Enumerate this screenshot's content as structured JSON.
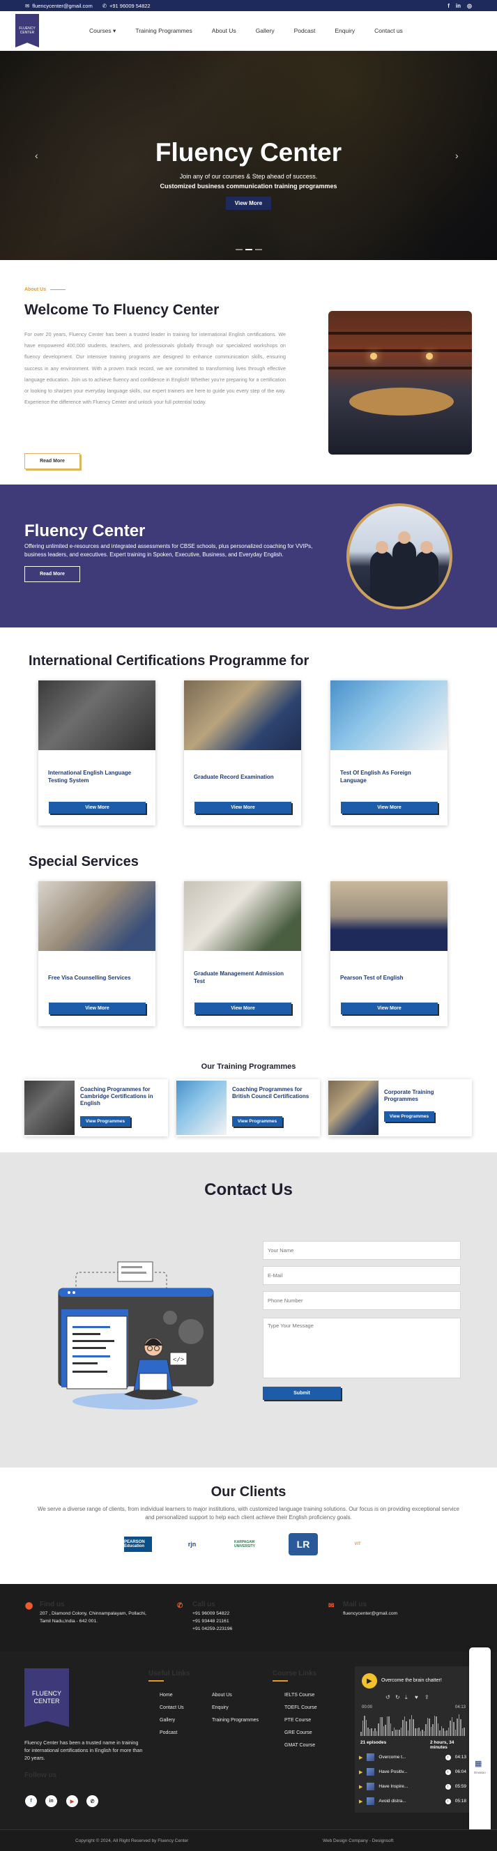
{
  "topbar": {
    "email": "fluencycenter@gmail.com",
    "phone": "+91 96009 54822",
    "social": [
      "f",
      "in",
      "◎"
    ]
  },
  "logo": {
    "line1": "FLUENCY",
    "line2": "CENTER"
  },
  "nav": {
    "items": [
      {
        "label": "Courses"
      },
      {
        "label": "Training Programmes"
      },
      {
        "label": "About Us"
      },
      {
        "label": "Gallery"
      },
      {
        "label": "Podcast"
      },
      {
        "label": "Enquiry"
      },
      {
        "label": "Contact us"
      }
    ]
  },
  "hero": {
    "title": "Fluency Center",
    "subtitle1": "Join any of our courses & Step ahead of success.",
    "subtitle2": "Customized business communication training programmes",
    "button": "View More"
  },
  "about": {
    "eyebrow": "About Us",
    "title": "Welcome To Fluency Center",
    "text": "For over 20 years, Fluency Center has been a trusted leader in training for international English certifications. We have empowered 400,000 students, teachers, and professionals globally through our specialized workshops on fluency development. Our intensive training programs are designed to enhance communication skills, ensuring success in any environment. With a proven track record, we are committed to transforming lives through effective language education. Join us to achieve fluency and confidence in English! Whether you're preparing for a certification or looking to sharpen your everyday language skills, our expert trainers are here to guide you every step of the way. Experience the difference with Fluency Center and unlock your full potential today.",
    "button": "Read More"
  },
  "band": {
    "title": "Fluency Center",
    "text": "Offering unlimited e-resources and integrated assessments for CBSE schools, plus personalized coaching for VVIPs, business leaders, and executives. Expert training in Spoken, Executive, Business, and Everyday English.",
    "button": "Read More"
  },
  "certifications": {
    "title": "International Certifications Programme for",
    "cards": [
      {
        "title": "International English Language Testing System",
        "button": "View More"
      },
      {
        "title": "Graduate Record Examination",
        "button": "View More"
      },
      {
        "title": "Test Of English As Foreign Language",
        "button": "View More"
      }
    ]
  },
  "services": {
    "title": "Special Services",
    "cards": [
      {
        "title": "Free Visa Counselling Services",
        "button": "View More"
      },
      {
        "title": "Graduate Management Admission Test",
        "button": "View More"
      },
      {
        "title": "Pearson Test of English",
        "button": "View More"
      }
    ]
  },
  "training": {
    "title": "Our Training Programmes",
    "cards": [
      {
        "title": "Coaching Programmes for Cambridge Certifications in English",
        "button": "View Programmes"
      },
      {
        "title": "Coaching Programmes for British Council Certifications",
        "button": "View Programmes"
      },
      {
        "title": "Corporate Training Programmes",
        "button": "View Programmes"
      }
    ]
  },
  "contact": {
    "title": "Contact Us",
    "name_placeholder": "Your Name",
    "email_placeholder": "E-Mail",
    "phone_placeholder": "Phone Number",
    "message_placeholder": "Type Your Message",
    "submit": "Submit"
  },
  "clients": {
    "title": "Our Clients",
    "text": "We serve a diverse range of clients, from individual learners to major institutions, with customized language training solutions. Our focus is on providing exceptional service and personalized support to help each client achieve their English proficiency goals.",
    "logos": [
      "PEARSON Education",
      "rjn",
      "KARPAGAM UNIVERSITY",
      "LR",
      "VIT"
    ]
  },
  "info": {
    "find_label": "Find us",
    "find_value1": "207 , Diamond Colony, Chinnampalayam, Pollachi,",
    "find_value2": "Tamil Nadu,India - 642 001.",
    "call_label": "Call us",
    "call_value1": "+91 96009 54822",
    "call_value2": "+91 93448 21161",
    "call_value3": "+91 04259-223196",
    "mail_label": "Mail us",
    "mail_value": "fluencycenter@gmail.com"
  },
  "footer": {
    "about": "Fluency Center has been a trusted name in training for international certifications in English for more than 20 years.",
    "follow": "Follow us",
    "useful_links_title": "Useful Links",
    "useful_links": [
      "Home",
      "Contact Us",
      "Gallery",
      "Podcast"
    ],
    "useful_links2": [
      "About Us",
      "Enquiry",
      "Training Programmes"
    ],
    "course_links_title": "Course Links",
    "course_links": [
      "IELTS Course",
      "TOEFL Course",
      "PTE Course",
      "GRE Course",
      "GMAT Course"
    ],
    "copyright": "Copyright © 2024, All Right Reserved by Fluency Center",
    "credit": "Web Design Company - Designsoft"
  },
  "podcast": {
    "title": "Overcome the brain chatter!",
    "time_start": "00:00",
    "time_end": "04:13",
    "episodes_count": "21 episodes",
    "duration": "2 hours, 34 minutes",
    "episodes": [
      {
        "name": "Overcome t...",
        "time": "04:13"
      },
      {
        "name": "Have Positiv...",
        "time": "06:04"
      },
      {
        "name": "Have Inspire...",
        "time": "05:59"
      },
      {
        "name": "Avoid distra...",
        "time": "05:18"
      }
    ]
  },
  "widget": {
    "label": "Envatoo"
  }
}
